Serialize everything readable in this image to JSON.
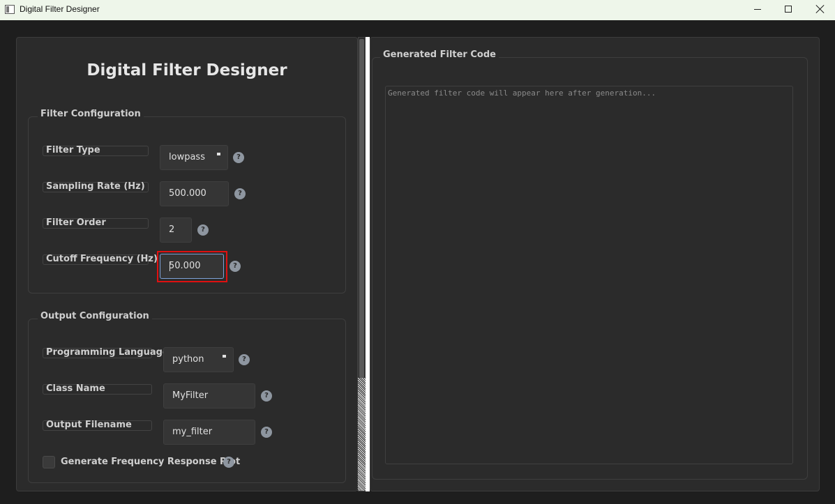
{
  "window": {
    "title": "Digital Filter Designer",
    "controls": [
      "minimize",
      "maximize",
      "close"
    ]
  },
  "left": {
    "heading": "Digital Filter Designer",
    "filter_config": {
      "title": "Filter Configuration",
      "filter_type": {
        "label": "Filter Type",
        "value": "lowpass"
      },
      "sampling_rate": {
        "label": "Sampling Rate (Hz)",
        "value": "500.000"
      },
      "filter_order": {
        "label": "Filter Order",
        "value": "2"
      },
      "cutoff": {
        "label": "Cutoff Frequency (Hz)",
        "value": "50.000"
      }
    },
    "output_config": {
      "title": "Output Configuration",
      "language": {
        "label": "Programming Language",
        "value": "python"
      },
      "class_name": {
        "label": "Class Name",
        "value": "MyFilter"
      },
      "filename": {
        "label": "Output Filename",
        "value": "my_filter"
      },
      "plot_checkbox": {
        "label": "Generate Frequency Response Plot",
        "checked": false
      }
    },
    "help_glyph": "?"
  },
  "right": {
    "title": "Generated Filter Code",
    "placeholder": "Generated filter code will appear here after generation..."
  },
  "colors": {
    "background": "#1e1e1e",
    "panel": "#2b2b2b",
    "focus_highlight": "#e01010",
    "help_icon": "#8e96a0"
  }
}
